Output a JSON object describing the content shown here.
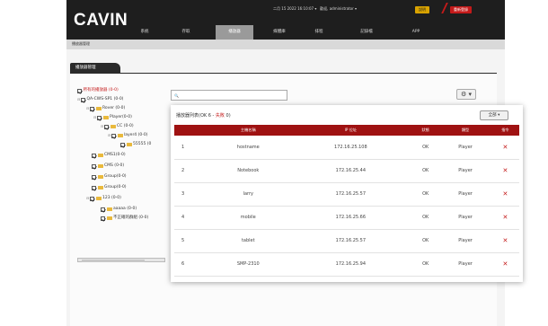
{
  "app": {
    "logo": "CAVIN"
  },
  "topbar": {
    "datetime": "二月 15 2022 16:10:07 ▾",
    "user": "歡迎, administrator ▾",
    "yellow_btn": "說明",
    "red_btn": "重新登錄"
  },
  "nav": [
    {
      "label": "系統"
    },
    {
      "label": "存取"
    },
    {
      "label": "播放器",
      "active": true
    },
    {
      "label": "媒體庫"
    },
    {
      "label": "排程"
    },
    {
      "label": "記錄檔"
    },
    {
      "label": "APP"
    }
  ],
  "breadcrumb": "播放器管理",
  "section_title": "播放器管理",
  "tree": [
    {
      "label": "所有的播放器 (0-0)",
      "level": 0,
      "checkbox": true,
      "folder": false
    },
    {
      "label": "QA-CWS-SP1 (0-0)",
      "level": 0,
      "checkbox": true,
      "folder": false
    },
    {
      "label": "Rover (0-0)",
      "level": 1,
      "checkbox": true,
      "folder": true
    },
    {
      "label": "Player(0-0)",
      "level": 2,
      "checkbox": true,
      "folder": true
    },
    {
      "label": "CC (0-0)",
      "level": 3,
      "checkbox": true,
      "folder": true
    },
    {
      "label": "layer4 (0-0)",
      "level": 4,
      "checkbox": true,
      "folder": true
    },
    {
      "label": "55555 (0",
      "level": 5,
      "checkbox": true,
      "folder": true
    },
    {
      "label": "CMS1(0-0)",
      "level": 1,
      "checkbox": true,
      "folder": true
    },
    {
      "label": "CMS (0-0)",
      "level": 1,
      "checkbox": true,
      "folder": true
    },
    {
      "label": "Group(0-0)",
      "level": 1,
      "checkbox": true,
      "folder": true
    },
    {
      "label": "Group(0-0)",
      "level": 1,
      "checkbox": true,
      "folder": true
    },
    {
      "label": "123 (0-0)",
      "level": 1,
      "checkbox": true,
      "folder": true
    },
    {
      "label": "aaaaa (0-0)",
      "level": 2,
      "checkbox": true,
      "folder": true
    },
    {
      "label": "不正確的群組 (0-0)",
      "level": 2,
      "checkbox": true,
      "folder": true
    }
  ],
  "search": {
    "placeholder": "🔍"
  },
  "gear_button": "⚙ ▾",
  "panel": {
    "title_prefix": "播放器列表(OK 6 - ",
    "title_offline": "失敗",
    "title_suffix": " 0)",
    "all_button": "全部 ▾",
    "columns": [
      "",
      "主機名稱",
      "IP 位址",
      "狀態",
      "類型",
      "指令"
    ],
    "rows": [
      {
        "idx": "1",
        "host": "hostname",
        "ip": "172.16.25.108",
        "status": "OK",
        "type": "Player",
        "action": "✕"
      },
      {
        "idx": "2",
        "host": "Notebook",
        "ip": "172.16.25.44",
        "status": "OK",
        "type": "Player",
        "action": "✕"
      },
      {
        "idx": "3",
        "host": "larry",
        "ip": "172.16.25.57",
        "status": "OK",
        "type": "Player",
        "action": "✕"
      },
      {
        "idx": "4",
        "host": "mobile",
        "ip": "172.16.25.66",
        "status": "OK",
        "type": "Player",
        "action": "✕"
      },
      {
        "idx": "5",
        "host": "tablet",
        "ip": "172.16.25.57",
        "status": "OK",
        "type": "Player",
        "action": "✕"
      },
      {
        "idx": "6",
        "host": "SMP-2310",
        "ip": "172.16.25.94",
        "status": "OK",
        "type": "Player",
        "action": "✕"
      }
    ]
  },
  "colors": {
    "accent": "#9f1212",
    "header": "#1e1e1e",
    "folder": "#e9b93c",
    "delete": "#c41a1a"
  }
}
